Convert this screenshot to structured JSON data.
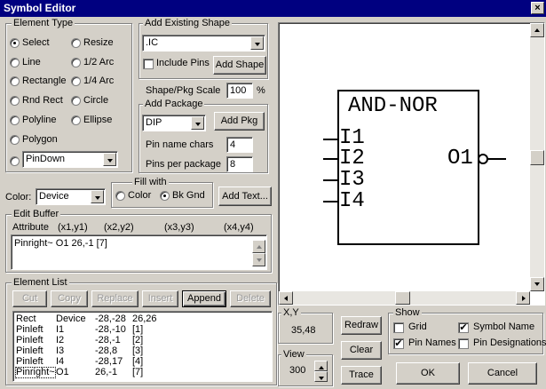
{
  "window": {
    "title": "Symbol Editor",
    "close_glyph": "×"
  },
  "element_type": {
    "legend": "Element Type",
    "options": [
      {
        "label": "Select",
        "selected": true
      },
      {
        "label": "Resize",
        "selected": false
      },
      {
        "label": "Line",
        "selected": false
      },
      {
        "label": "1/2 Arc",
        "selected": false
      },
      {
        "label": "Rectangle",
        "selected": false
      },
      {
        "label": "1/4 Arc",
        "selected": false
      },
      {
        "label": "Rnd Rect",
        "selected": false
      },
      {
        "label": "Circle",
        "selected": false
      },
      {
        "label": "Polyline",
        "selected": false
      },
      {
        "label": "Ellipse",
        "selected": false
      },
      {
        "label": "Polygon",
        "selected": false
      }
    ],
    "pin_dropdown_value": "PinDown"
  },
  "add_existing_shape": {
    "legend": "Add Existing Shape",
    "shape_value": ".IC",
    "include_pins_label": "Include Pins",
    "include_pins_checked": false,
    "add_shape_label": "Add Shape"
  },
  "scale": {
    "label": "Shape/Pkg Scale",
    "value": "100",
    "unit": "%"
  },
  "add_package": {
    "legend": "Add Package",
    "package_value": "DIP",
    "add_pkg_label": "Add Pkg",
    "pin_name_chars_label": "Pin name chars",
    "pin_name_chars_value": "4",
    "pins_per_package_label": "Pins per package",
    "pins_per_package_value": "8"
  },
  "color": {
    "label": "Color:",
    "value": "Device"
  },
  "fill_with": {
    "legend": "Fill with",
    "options": [
      {
        "label": "Color",
        "selected": false
      },
      {
        "label": "Bk Gnd",
        "selected": true
      }
    ]
  },
  "add_text_label": "Add Text...",
  "edit_buffer": {
    "legend": "Edit Buffer",
    "headers": [
      "Attribute",
      "(x1,y1)",
      "(x2,y2)",
      "(x3,y3)",
      "(x4,y4)"
    ],
    "content": "Pinright~ O1 26,-1 [7]"
  },
  "element_list": {
    "legend": "Element List",
    "buttons": [
      {
        "label": "Cut",
        "enabled": false
      },
      {
        "label": "Copy",
        "enabled": false
      },
      {
        "label": "Replace",
        "enabled": false
      },
      {
        "label": "Insert",
        "enabled": false
      },
      {
        "label": "Append",
        "enabled": true
      },
      {
        "label": "Delete",
        "enabled": false
      }
    ],
    "rows": [
      {
        "type": "Rect",
        "name": "Device",
        "c1": "-28,-28",
        "c2": "26,26"
      },
      {
        "type": "Pinleft",
        "name": "I1",
        "c1": "-28,-10",
        "c2": "[1]"
      },
      {
        "type": "Pinleft",
        "name": "I2",
        "c1": "-28,-1",
        "c2": "[2]"
      },
      {
        "type": "Pinleft",
        "name": "I3",
        "c1": "-28,8",
        "c2": "[3]"
      },
      {
        "type": "Pinleft",
        "name": "I4",
        "c1": "-28,17",
        "c2": "[4]"
      },
      {
        "type": "Pinright~",
        "name": "O1",
        "c1": "26,-1",
        "c2": "[7]"
      }
    ]
  },
  "symbol": {
    "title": "AND-NOR",
    "inputs": [
      "I1",
      "I2",
      "I3",
      "I4"
    ],
    "output": "O1"
  },
  "xy": {
    "label": "X,Y",
    "value": "35,48"
  },
  "view": {
    "label": "View",
    "value": "300"
  },
  "buttons": {
    "redraw": "Redraw",
    "clear": "Clear",
    "trace": "Trace",
    "ok": "OK",
    "cancel": "Cancel"
  },
  "show": {
    "legend": "Show",
    "options": [
      {
        "label": "Grid",
        "checked": false
      },
      {
        "label": "Symbol Name",
        "checked": true
      },
      {
        "label": "Pin Names",
        "checked": true
      },
      {
        "label": "Pin Designations",
        "checked": false
      }
    ]
  }
}
